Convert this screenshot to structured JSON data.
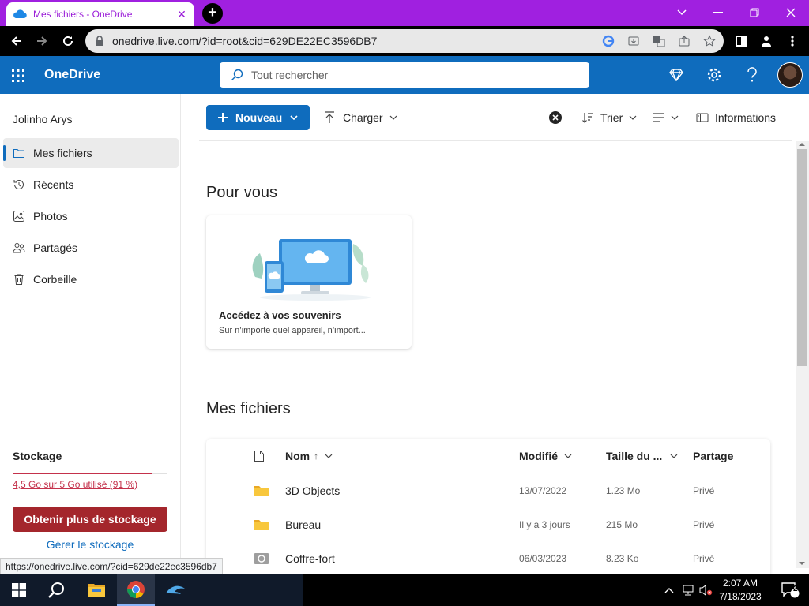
{
  "browser": {
    "tab_title": "Mes fichiers - OneDrive",
    "tab_close": "✕",
    "new_tab": "+",
    "url": "onedrive.live.com/?id=root&cid=629DE22EC3596DB7",
    "status_url": "https://onedrive.live.com/?cid=629de22ec3596db7"
  },
  "app": {
    "brand": "OneDrive",
    "search_placeholder": "Tout rechercher"
  },
  "sidebar": {
    "user": "Jolinho Arys",
    "items": [
      {
        "label": "Mes fichiers",
        "icon": "folder-icon",
        "active": true
      },
      {
        "label": "Récents",
        "icon": "history-icon"
      },
      {
        "label": "Photos",
        "icon": "image-icon"
      },
      {
        "label": "Partagés",
        "icon": "people-icon"
      },
      {
        "label": "Corbeille",
        "icon": "trash-icon"
      }
    ],
    "storage": {
      "title": "Stockage",
      "usage": "4,5 Go sur 5 Go utilisé (91 %)",
      "used_fraction": 0.91,
      "cta": "Obtenir plus de stockage",
      "manage": "Gérer le stockage"
    }
  },
  "commandbar": {
    "new": "Nouveau",
    "upload": "Charger",
    "sort": "Trier",
    "info": "Informations"
  },
  "foryou": {
    "heading": "Pour vous",
    "card_title": "Accédez à vos souvenirs",
    "card_sub": "Sur n’importe quel appareil, n’import..."
  },
  "files": {
    "heading": "Mes fichiers",
    "columns": {
      "name": "Nom",
      "name_sort": "↑",
      "modified": "Modifié",
      "size": "Taille du ...",
      "sharing": "Partage"
    },
    "rows": [
      {
        "name": "3D Objects",
        "modified": "13/07/2022",
        "size": "1.23 Mo",
        "sharing": "Privé",
        "type": "folder"
      },
      {
        "name": "Bureau",
        "modified": "Il y a 3 jours",
        "size": "215 Mo",
        "sharing": "Privé",
        "type": "folder"
      },
      {
        "name": "Coffre-fort",
        "modified": "06/03/2023",
        "size": "8.23 Ko",
        "sharing": "Privé",
        "type": "vault"
      }
    ]
  },
  "taskbar": {
    "time": "2:07 AM",
    "date": "7/18/2023",
    "notification_count": "2"
  },
  "colors": {
    "tabstrip": "#a020e0",
    "onedrive_blue": "#0f6cbd",
    "storage_red": "#a4262c",
    "folder_yellow": "#f8c73d"
  }
}
